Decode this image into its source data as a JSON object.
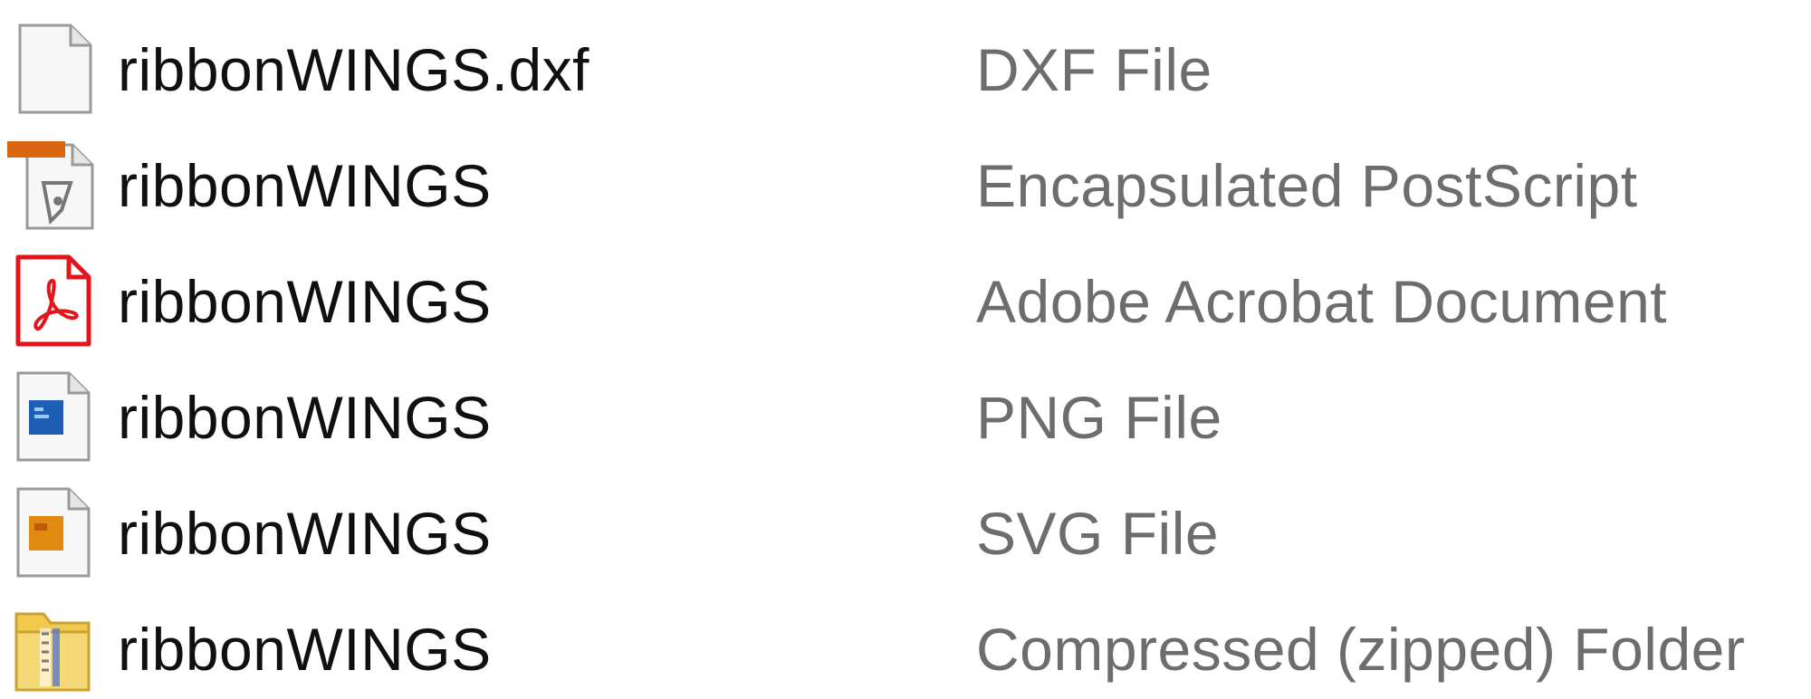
{
  "files": [
    {
      "name": "ribbonWINGS.dxf",
      "type": "DXF File",
      "icon": "blank-document-icon"
    },
    {
      "name": "ribbonWINGS",
      "type": "Encapsulated PostScript",
      "icon": "eps-document-icon"
    },
    {
      "name": "ribbonWINGS",
      "type": "Adobe Acrobat Document",
      "icon": "pdf-icon"
    },
    {
      "name": "ribbonWINGS",
      "type": "PNG File",
      "icon": "png-image-icon"
    },
    {
      "name": "ribbonWINGS",
      "type": "SVG File",
      "icon": "svg-image-icon"
    },
    {
      "name": "ribbonWINGS",
      "type": "Compressed (zipped) Folder",
      "icon": "zip-folder-icon"
    }
  ],
  "colors": {
    "name_text": "#101010",
    "type_text": "#6d6d6d",
    "pdf_red": "#e3151a",
    "eps_orange": "#d9670f",
    "png_blue": "#1c5fb4",
    "svg_orange": "#e08a12",
    "zip_yellow": "#f2c94c"
  }
}
